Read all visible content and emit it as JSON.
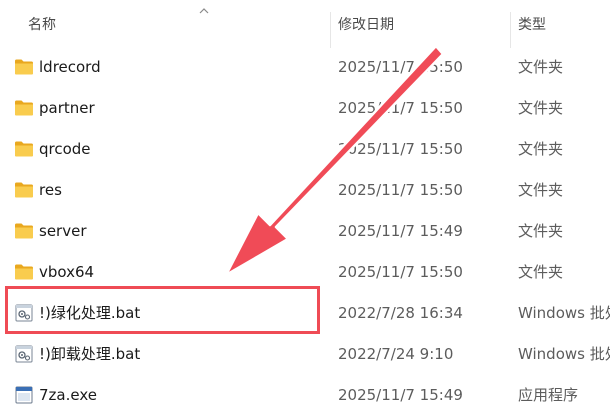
{
  "columns": {
    "name": "名称",
    "date": "修改日期",
    "type": "类型"
  },
  "rows": [
    {
      "icon": "folder-icon",
      "name": "ldrecord",
      "date": "2025/11/7 15:50",
      "type": "文件夹"
    },
    {
      "icon": "folder-icon",
      "name": "partner",
      "date": "2025/11/7 15:50",
      "type": "文件夹"
    },
    {
      "icon": "folder-icon",
      "name": "qrcode",
      "date": "2025/11/7 15:50",
      "type": "文件夹"
    },
    {
      "icon": "folder-icon",
      "name": "res",
      "date": "2025/11/7 15:50",
      "type": "文件夹"
    },
    {
      "icon": "folder-icon",
      "name": "server",
      "date": "2025/11/7 15:49",
      "type": "文件夹"
    },
    {
      "icon": "folder-icon",
      "name": "vbox64",
      "date": "2025/11/7 15:50",
      "type": "文件夹"
    },
    {
      "icon": "batch-file-icon",
      "name": "!)绿化处理.bat",
      "date": "2022/7/28 16:34",
      "type": "Windows 批处理文件"
    },
    {
      "icon": "batch-file-icon",
      "name": "!)卸载处理.bat",
      "date": "2022/7/24 9:10",
      "type": "Windows 批处理文件"
    },
    {
      "icon": "exe-file-icon",
      "name": "7za.exe",
      "date": "2025/11/7 15:49",
      "type": "应用程序"
    }
  ],
  "colors": {
    "annotation": "#ef4b55",
    "folder": "#f7c948",
    "header_text": "#4a4a4a",
    "meta_text": "#5c5c5c"
  }
}
